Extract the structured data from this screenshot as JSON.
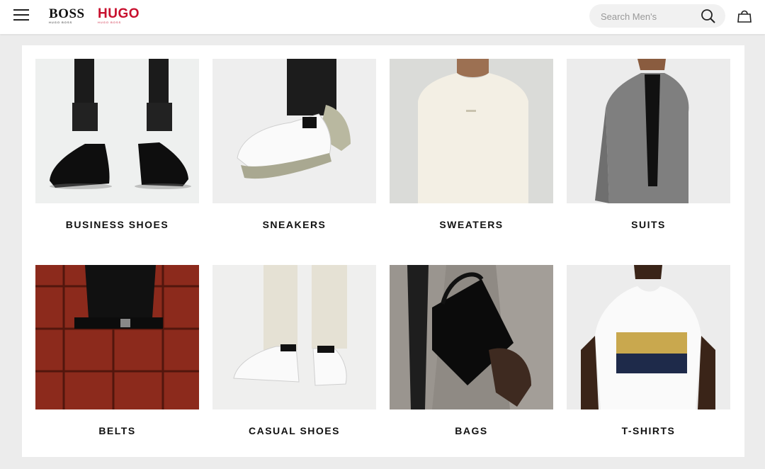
{
  "header": {
    "menu_label": "Menu",
    "brands": [
      {
        "name": "BOSS",
        "sub": "HUGO BOSS",
        "color": "#111111"
      },
      {
        "name": "HUGO",
        "sub": "HUGO BOSS",
        "color": "#c8102e"
      }
    ],
    "search": {
      "placeholder": "Search Men's",
      "value": ""
    },
    "icons": {
      "menu": "hamburger-icon",
      "search": "search-icon",
      "cart": "shopping-bag-icon"
    }
  },
  "categories": [
    {
      "label": "BUSINESS SHOES",
      "image": "black-derby-shoes"
    },
    {
      "label": "SNEAKERS",
      "image": "white-chunky-sneakers"
    },
    {
      "label": "SWEATERS",
      "image": "cream-knit-sweater"
    },
    {
      "label": "SUITS",
      "image": "grey-blazer"
    },
    {
      "label": "BELTS",
      "image": "black-belt-plaid-suit"
    },
    {
      "label": "CASUAL SHOES",
      "image": "white-leather-sneakers"
    },
    {
      "label": "BAGS",
      "image": "black-leather-bag"
    },
    {
      "label": "T-SHIRTS",
      "image": "white-graphic-tshirt"
    }
  ],
  "colors": {
    "accent": "#c8102e",
    "background": "#ececec",
    "panel": "#ffffff"
  }
}
